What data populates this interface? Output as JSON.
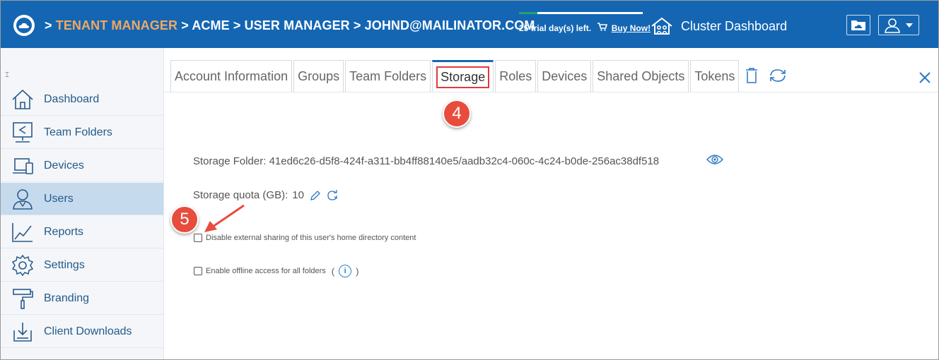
{
  "header": {
    "breadcrumb": [
      {
        "sep": ">",
        "label": "TENANT MANAGER"
      },
      {
        "sep": ">",
        "label": "ACME"
      },
      {
        "sep": ">",
        "label": "USER MANAGER"
      },
      {
        "sep": ">",
        "label": "JOHND@MAILINATOR.COM"
      }
    ],
    "trial_text": "25 trial day(s) left.",
    "trial_progress": 0.15,
    "buy_now": "Buy Now!",
    "cluster_dashboard": "Cluster Dashboard",
    "colors": {
      "header_bg": "#1466b3",
      "tenant_accent": "#f0a860"
    }
  },
  "sidebar": {
    "collapse_icon": "⌶",
    "items": [
      {
        "label": "Dashboard",
        "icon": "home-icon"
      },
      {
        "label": "Team Folders",
        "icon": "team-folder-icon"
      },
      {
        "label": "Devices",
        "icon": "devices-icon"
      },
      {
        "label": "Users",
        "icon": "users-icon",
        "active": true
      },
      {
        "label": "Reports",
        "icon": "reports-icon"
      },
      {
        "label": "Settings",
        "icon": "gear-icon"
      },
      {
        "label": "Branding",
        "icon": "paint-roller-icon"
      },
      {
        "label": "Client Downloads",
        "icon": "download-icon"
      }
    ]
  },
  "tabs": [
    {
      "label": "Account Information"
    },
    {
      "label": "Groups"
    },
    {
      "label": "Team Folders"
    },
    {
      "label": "Storage",
      "active": true
    },
    {
      "label": "Roles"
    },
    {
      "label": "Devices"
    },
    {
      "label": "Shared Objects"
    },
    {
      "label": "Tokens"
    }
  ],
  "annotations": {
    "step4": "4",
    "step5": "5"
  },
  "storage": {
    "folder_label": "Storage Folder:",
    "folder_value": "41ed6c26-d5f8-424f-a311-bb4ff88140e5/aadb32c4-060c-4c24-b0de-256ac38df518",
    "quota_label": "Storage quota (GB):",
    "quota_value": "10",
    "option1": {
      "label": "Disable external sharing of this user's home directory content",
      "checked": false
    },
    "option2": {
      "label": "Enable offline access for all folders",
      "checked": false,
      "paren_open": "(",
      "paren_close": ")"
    }
  }
}
